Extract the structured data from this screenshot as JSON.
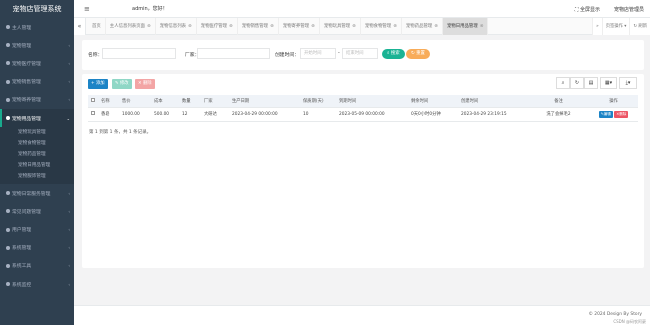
{
  "app": {
    "title": "宠物店管理系统"
  },
  "sidebar": {
    "items": [
      {
        "label": "主人管理"
      },
      {
        "label": "宠物管理"
      },
      {
        "label": "宠物医疗管理"
      },
      {
        "label": "宠物销售管理"
      },
      {
        "label": "宠物寄养管理"
      },
      {
        "label": "宠物用品管理"
      }
    ],
    "subitems": [
      "宠物玩具管理",
      "宠物食物管理",
      "宠物药品管理",
      "宠物日用品管理",
      "宠物服饰管理"
    ],
    "items2": [
      {
        "label": "宠物日常服务管理"
      },
      {
        "label": "常见问题管理"
      },
      {
        "label": "用户管理"
      },
      {
        "label": "系统管理"
      },
      {
        "label": "系统工具"
      },
      {
        "label": "系统监控"
      }
    ]
  },
  "topbar": {
    "welcome": "admin，您好！",
    "fullscreen": "全屏显示",
    "system": "宠物店管理员"
  },
  "tabs": [
    "首页",
    "主人信息列表页面",
    "宠物信息列表",
    "宠物医疗管理",
    "宠物销售管理",
    "宠物寄养管理",
    "宠物玩具管理",
    "宠物食物管理",
    "宠物药品管理",
    "宠物日用品管理"
  ],
  "tabbar_right": {
    "ops": "页签操作 ▾",
    "refresh": "刷新"
  },
  "search": {
    "name_label": "名称：",
    "factory_label": "厂家：",
    "time_label": "创建时间：",
    "start_placeholder": "开始时间",
    "sep": "-",
    "end_placeholder": "结束时间",
    "search_btn": "搜索",
    "reset_btn": "重置"
  },
  "toolbar": {
    "add": "+ 添加",
    "edit": "修改",
    "delete": "删除"
  },
  "table": {
    "headers": [
      "名称",
      "售价",
      "成本",
      "数量",
      "厂家",
      "生产日期",
      "保质期(天)",
      "到期时间",
      "剩余时间",
      "创建时间",
      "备注",
      "操作"
    ],
    "rows": [
      {
        "cells": [
          "香皂",
          "1000.00",
          "500.00",
          "12",
          "大研达",
          "2023-04-29 00:00:00",
          "10",
          "2023-05-09 00:00:00",
          "0天0小时0分钟",
          "2023-04-29 23:19:15",
          "洗了会掉毛2"
        ],
        "edit": "编辑",
        "delete": "删除"
      }
    ]
  },
  "pageinfo": "第 1 到第 1 条，共 1 条记录。",
  "footer": {
    "copyright": "© 2024 Design By Story",
    "watermark": "CSDN @码农阿豪"
  }
}
